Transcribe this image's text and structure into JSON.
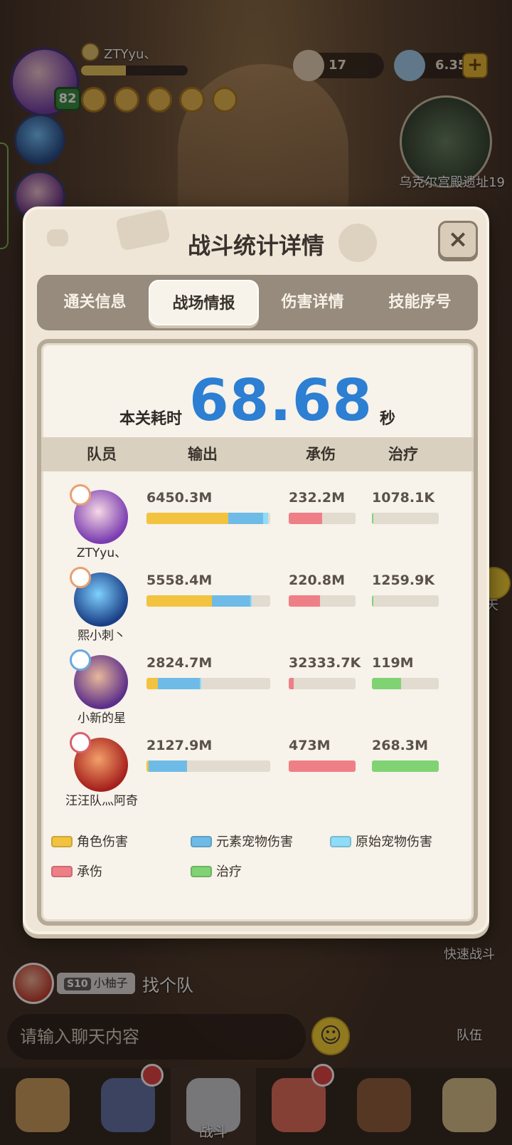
{
  "hud": {
    "player_name": "ZTYyu、",
    "level": "82",
    "currency1": "17",
    "currency2": "6.35M",
    "map_name": "乌克尔宫殿遗址19",
    "chat_float_label": "聊天",
    "quick_battle_label": "快速战斗",
    "team_label": "队伍"
  },
  "chat": {
    "sender_tag": "S10",
    "sender_name": "小柚子",
    "message": "找个队",
    "input_placeholder": "请输入聊天内容"
  },
  "nav": {
    "items": [
      {
        "label": "",
        "icon": "monster-icon"
      },
      {
        "label": "",
        "icon": "character-icon"
      },
      {
        "label": "战斗",
        "icon": "sword-icon"
      },
      {
        "label": "",
        "icon": "pet-icon"
      },
      {
        "label": "",
        "icon": "bear-icon"
      },
      {
        "label": "",
        "icon": "tent-icon"
      }
    ]
  },
  "modal": {
    "title": "战斗统计详情",
    "close_icon": "×",
    "tabs": [
      {
        "label": "通关信息",
        "active": false
      },
      {
        "label": "战场情报",
        "active": true
      },
      {
        "label": "伤害详情",
        "active": false
      },
      {
        "label": "技能序号",
        "active": false
      }
    ],
    "time_label": "本关耗时",
    "time_value": "68.68",
    "time_unit": "秒",
    "columns": {
      "member": "队员",
      "output": "输出",
      "tank": "承伤",
      "heal": "治疗"
    },
    "rows": [
      {
        "name": "ZTYyu、",
        "output": "6450.3M",
        "tank": "232.2M",
        "heal": "1078.1K",
        "output_role": 0.66,
        "output_elem": 0.28,
        "output_orig": 0.04,
        "tank_frac": 0.5,
        "heal_frac": 0.02
      },
      {
        "name": "熙小刺丶",
        "output": "5558.4M",
        "tank": "220.8M",
        "heal": "1259.9K",
        "output_role": 0.53,
        "output_elem": 0.31,
        "output_orig": 0.01,
        "tank_frac": 0.47,
        "heal_frac": 0.02
      },
      {
        "name": "小新的星",
        "output": "2824.7M",
        "tank": "32333.7K",
        "heal": "119M",
        "output_role": 0.09,
        "output_elem": 0.34,
        "output_orig": 0.01,
        "tank_frac": 0.07,
        "heal_frac": 0.44
      },
      {
        "name": "汪汪队灬阿奇",
        "output": "2127.9M",
        "tank": "473M",
        "heal": "268.3M",
        "output_role": 0.02,
        "output_elem": 0.31,
        "output_orig": 0.0,
        "tank_frac": 1.0,
        "heal_frac": 1.0
      }
    ],
    "legend": {
      "role": "角色伤害",
      "elem": "元素宠物伤害",
      "orig": "原始宠物伤害",
      "tank": "承伤",
      "heal": "治疗"
    },
    "colors": {
      "role": "#f2c33f",
      "elem": "#6fbbe8",
      "orig": "#8fdcf7",
      "tank": "#ee7f86",
      "heal": "#7fd373",
      "time": "#2c7fd2"
    }
  }
}
